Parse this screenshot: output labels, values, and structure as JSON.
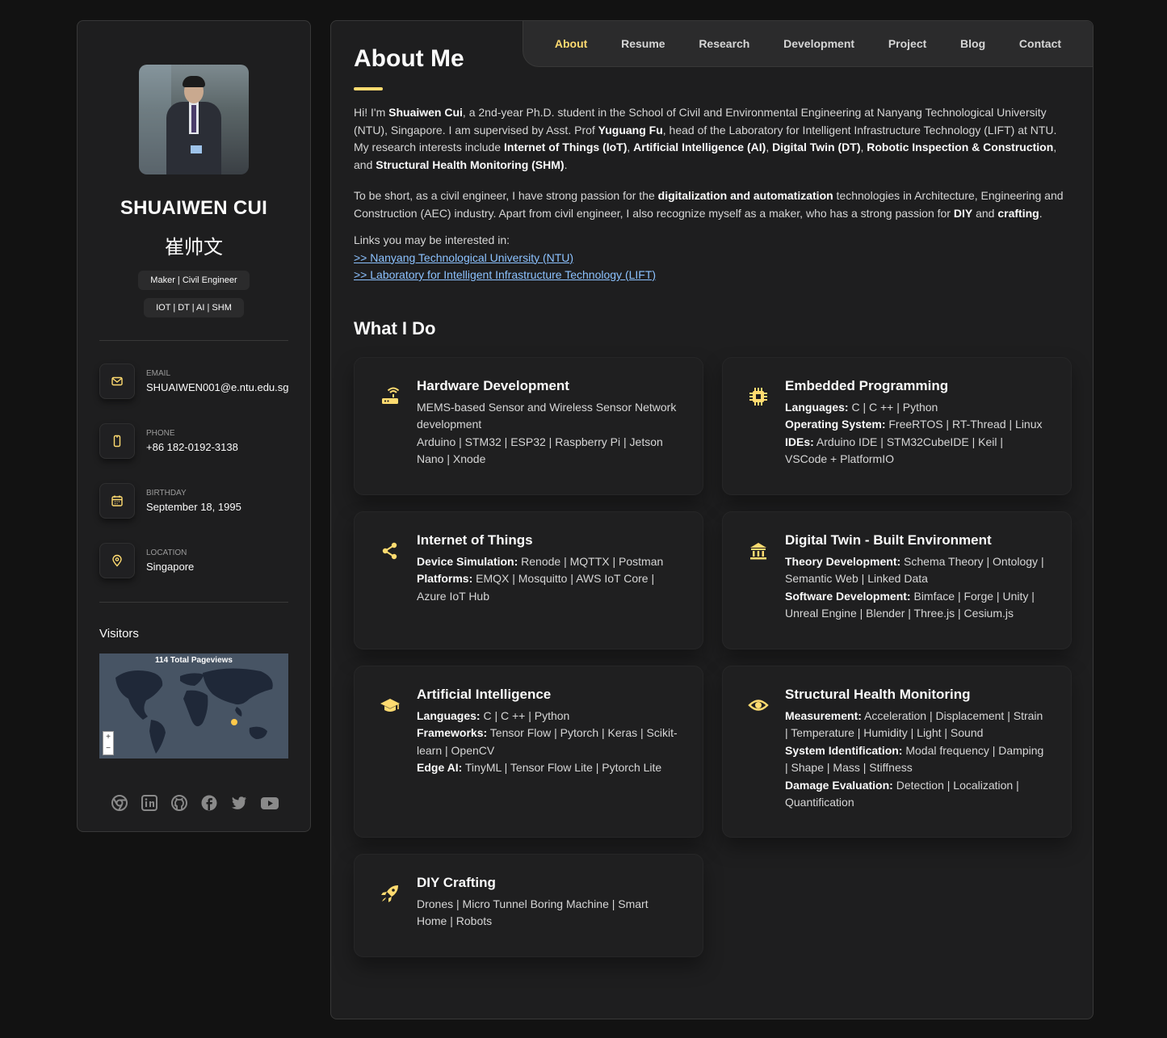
{
  "profile": {
    "name": "SHUAIWEN CUI",
    "name_cn": "崔帅文",
    "tags": [
      "Maker | Civil Engineer",
      "IOT | DT | AI | SHM"
    ]
  },
  "contacts": [
    {
      "label": "EMAIL",
      "value": "SHUAIWEN001@e.ntu.edu.sg",
      "icon": "mail-icon"
    },
    {
      "label": "PHONE",
      "value": "+86 182-0192-3138",
      "icon": "phone-icon"
    },
    {
      "label": "BIRTHDAY",
      "value": "September 18, 1995",
      "icon": "calendar-icon"
    },
    {
      "label": "LOCATION",
      "value": "Singapore",
      "icon": "location-icon"
    }
  ],
  "visitors": {
    "title": "Visitors",
    "map_title": "114 Total Pageviews",
    "zoom_in": "+",
    "zoom_out": "−"
  },
  "social_icons": [
    "chrome-icon",
    "linkedin-icon",
    "github-icon",
    "facebook-icon",
    "twitter-icon",
    "youtube-icon"
  ],
  "nav": [
    "About",
    "Resume",
    "Research",
    "Development",
    "Project",
    "Blog",
    "Contact"
  ],
  "nav_active": "About",
  "about": {
    "title": "About Me",
    "p1": [
      {
        "t": "Hi! I'm "
      },
      {
        "b": "Shuaiwen Cui"
      },
      {
        "t": ", a 2nd-year Ph.D. student in the School of Civil and Environmental Engineering at Nanyang Technological University (NTU), Singapore. I am supervised by Asst. Prof "
      },
      {
        "b": "Yuguang Fu"
      },
      {
        "t": ", head of the Laboratory for Intelligent Infrastructure Technology (LIFT) at NTU. My research interests include "
      },
      {
        "b": "Internet of Things (IoT)"
      },
      {
        "t": ", "
      },
      {
        "b": "Artificial Intelligence (AI)"
      },
      {
        "t": ", "
      },
      {
        "b": "Digital Twin (DT)"
      },
      {
        "t": ", "
      },
      {
        "b": "Robotic Inspection & Construction"
      },
      {
        "t": ", and "
      },
      {
        "b": "Structural Health Monitoring (SHM)"
      },
      {
        "t": "."
      }
    ],
    "p2": [
      {
        "t": "To be short, as a civil engineer, I have strong passion for the "
      },
      {
        "b": "digitalization and automatization"
      },
      {
        "t": " technologies in Architecture, Engineering and Construction (AEC) industry. Apart from civil engineer, I also recognize myself as a maker, who has a strong passion for "
      },
      {
        "b": "DIY"
      },
      {
        "t": " and "
      },
      {
        "b": "crafting"
      },
      {
        "t": "."
      }
    ],
    "links_intro": "Links you may be interested in:",
    "links": [
      ">> Nanyang Technological University (NTU)",
      ">> Laboratory for Intelligent Infrastructure Technology (LIFT)"
    ]
  },
  "what_i_do": {
    "title": "What I Do",
    "cards": [
      {
        "title": "Hardware Development",
        "icon": "router-icon",
        "size": "",
        "lines": [
          [
            {
              "t": "MEMS-based Sensor and Wireless Sensor Network development"
            }
          ],
          [
            {
              "t": "Arduino | STM32 | ESP32 | Raspberry Pi | Jetson Nano | Xnode"
            }
          ]
        ]
      },
      {
        "title": "Embedded Programming",
        "icon": "chip-icon",
        "size": "",
        "lines": [
          [
            {
              "b": "Languages:"
            },
            {
              "t": " C | C ++ | Python"
            }
          ],
          [
            {
              "b": "Operating System:"
            },
            {
              "t": " FreeRTOS | RT-Thread | Linux"
            }
          ],
          [
            {
              "b": "IDEs:"
            },
            {
              "t": " Arduino IDE | STM32CubeIDE | Keil | VSCode + PlatformIO"
            }
          ]
        ]
      },
      {
        "title": "Internet of Things",
        "icon": "share-icon",
        "size": "",
        "lines": [
          [
            {
              "b": "Device Simulation:"
            },
            {
              "t": " Renode | MQTTX | Postman"
            }
          ],
          [
            {
              "b": "Platforms:"
            },
            {
              "t": " EMQX | Mosquitto | AWS IoT Core | Azure IoT Hub"
            }
          ]
        ]
      },
      {
        "title": "Digital Twin - Built Environment",
        "icon": "building-icon",
        "size": "",
        "lines": [
          [
            {
              "b": "Theory Development:"
            },
            {
              "t": " Schema Theory | Ontology | Semantic Web | Linked Data"
            }
          ],
          [
            {
              "b": "Software Development:"
            },
            {
              "t": " Bimface | Forge | Unity | Unreal Engine | Blender | Three.js | Cesium.js"
            }
          ]
        ]
      },
      {
        "title": "Artificial Intelligence",
        "icon": "graduation-cap-icon",
        "size": "tall",
        "lines": [
          [
            {
              "b": "Languages:"
            },
            {
              "t": " C | C ++ | Python"
            }
          ],
          [
            {
              "b": "Frameworks:"
            },
            {
              "t": " Tensor Flow | Pytorch | Keras | Scikit-learn | OpenCV"
            }
          ],
          [
            {
              "b": "Edge AI:"
            },
            {
              "t": " TinyML | Tensor Flow Lite | Pytorch Lite"
            }
          ]
        ]
      },
      {
        "title": "Structural Health Monitoring",
        "icon": "eye-icon",
        "size": "tall",
        "lines": [
          [
            {
              "b": "Measurement:"
            },
            {
              "t": " Acceleration | Displacement | Strain | Temperature | Humidity | Light | Sound"
            }
          ],
          [
            {
              "b": "System Identification:"
            },
            {
              "t": " Modal frequency | Damping | Shape | Mass | Stiffness"
            }
          ],
          [
            {
              "b": "Damage Evaluation:"
            },
            {
              "t": " Detection | Localization | Quantification"
            }
          ]
        ]
      },
      {
        "title": "DIY Crafting",
        "icon": "rocket-icon",
        "size": "short",
        "lines": [
          [
            {
              "t": "Drones | Micro Tunnel Boring Machine | Smart Home | Robots"
            }
          ]
        ]
      }
    ]
  },
  "colors": {
    "accent": "#ffdb70",
    "bg": "#121212",
    "panel": "#1e1e1f",
    "link": "#8cc2ff"
  }
}
